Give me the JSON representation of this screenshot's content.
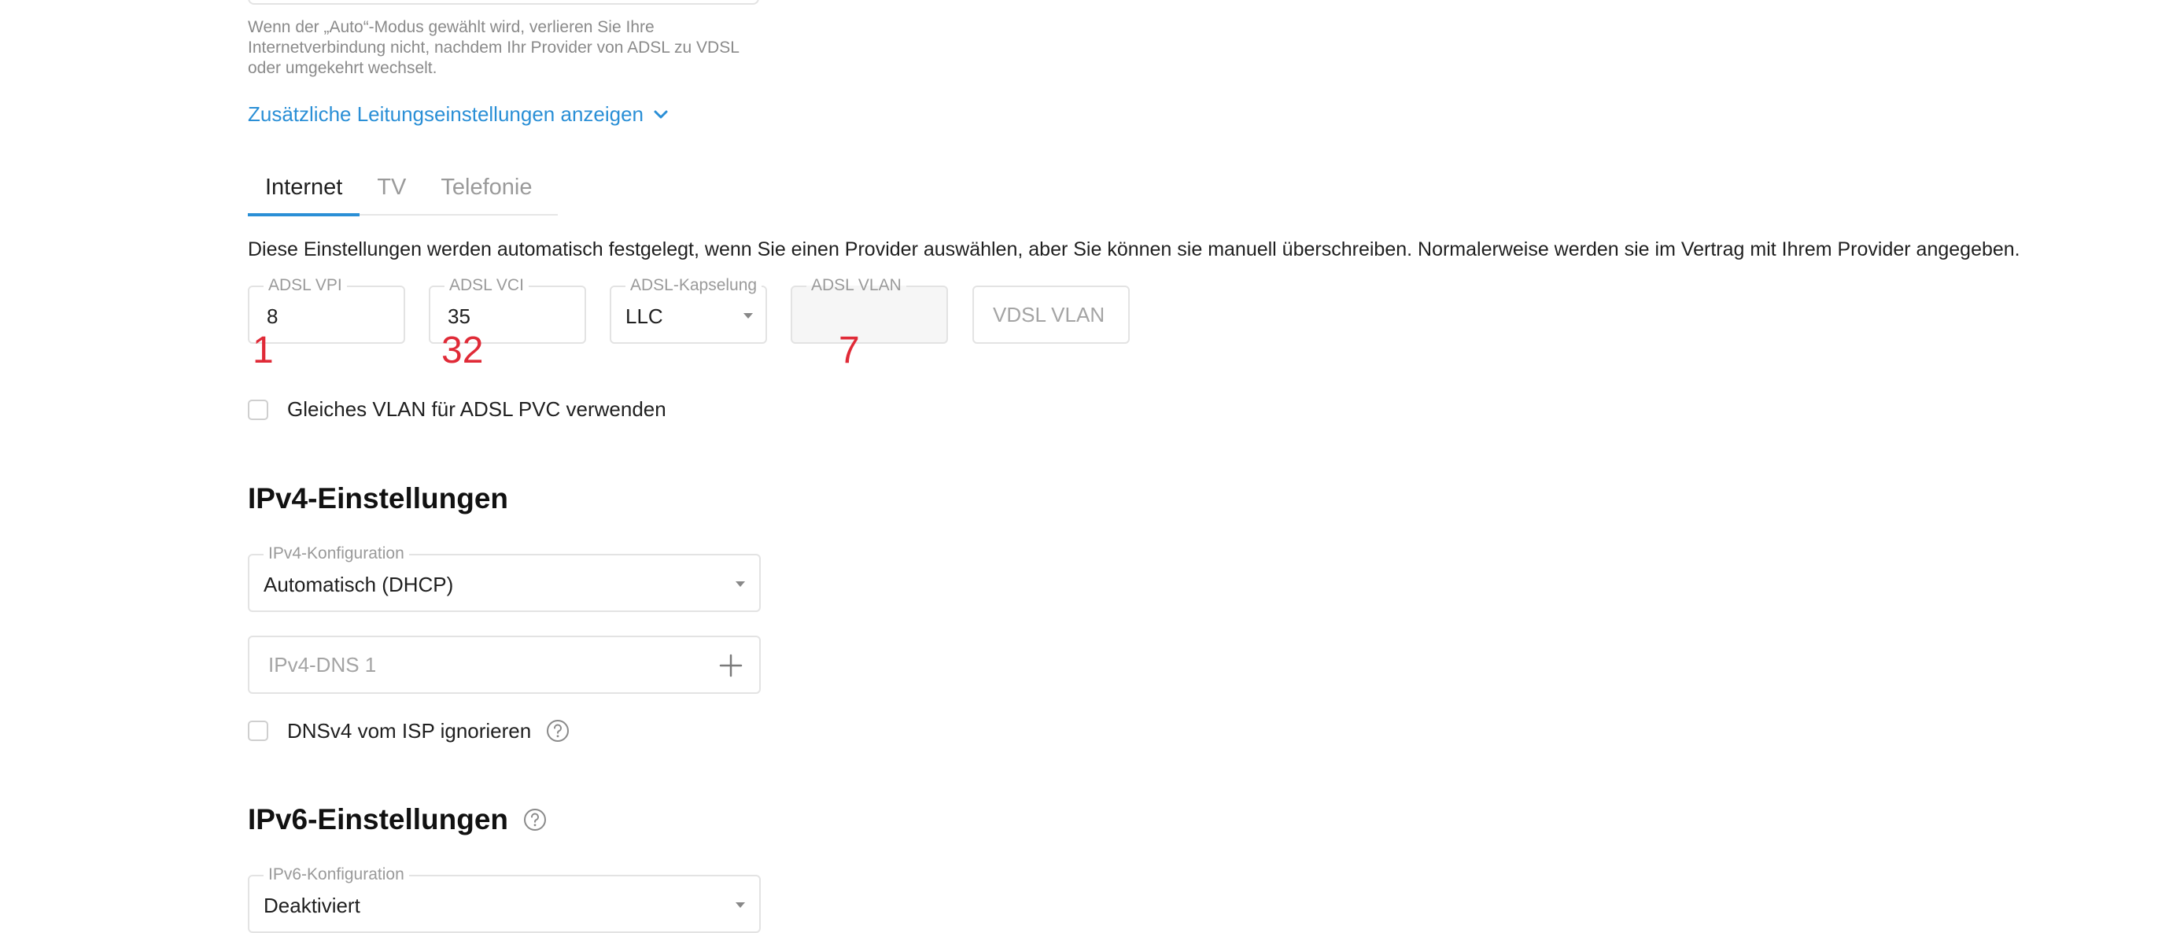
{
  "line_hint": "Wenn der „Auto“-Modus gewählt wird, verlieren Sie Ihre Internetverbindung nicht, nachdem Ihr Provider von ADSL zu VDSL oder umgekehrt wechselt.",
  "additional_settings_link": "Zusätzliche Leitungseinstellungen anzeigen",
  "tabs": [
    {
      "label": "Internet",
      "active": true
    },
    {
      "label": "TV",
      "active": false
    },
    {
      "label": "Telefonie",
      "active": false
    }
  ],
  "description": "Diese Einstellungen werden automatisch festgelegt, wenn Sie einen Provider auswählen, aber Sie können sie manuell überschreiben. Normalerweise werden sie im Vertrag mit Ihrem Provider angegeben.",
  "fields": {
    "adsl_vpi": {
      "label": "ADSL VPI",
      "value": "8"
    },
    "adsl_vci": {
      "label": "ADSL VCI",
      "value": "35"
    },
    "adsl_encapsulation": {
      "label": "ADSL-Kapselung",
      "value": "LLC"
    },
    "adsl_vlan": {
      "label": "ADSL VLAN",
      "value": ""
    },
    "vdsl_vlan": {
      "placeholder": "VDSL VLAN"
    }
  },
  "annotations": [
    "1",
    "32",
    "7"
  ],
  "same_vlan_label": "Gleiches VLAN für ADSL PVC verwenden",
  "ipv4": {
    "title": "IPv4-Einstellungen",
    "config_label": "IPv4-Konfiguration",
    "config_value": "Automatisch (DHCP)",
    "dns_placeholder": "IPv4-DNS 1",
    "ignore_dns_label": "DNSv4 vom ISP ignorieren"
  },
  "ipv6": {
    "title": "IPv6-Einstellungen",
    "config_label": "IPv6-Konfiguration",
    "config_value": "Deaktiviert"
  },
  "colors": {
    "accent": "#2a8fd6",
    "annotation": "#e02a37",
    "border": "#e3e3e3",
    "muted_text": "#9a9a9a"
  }
}
